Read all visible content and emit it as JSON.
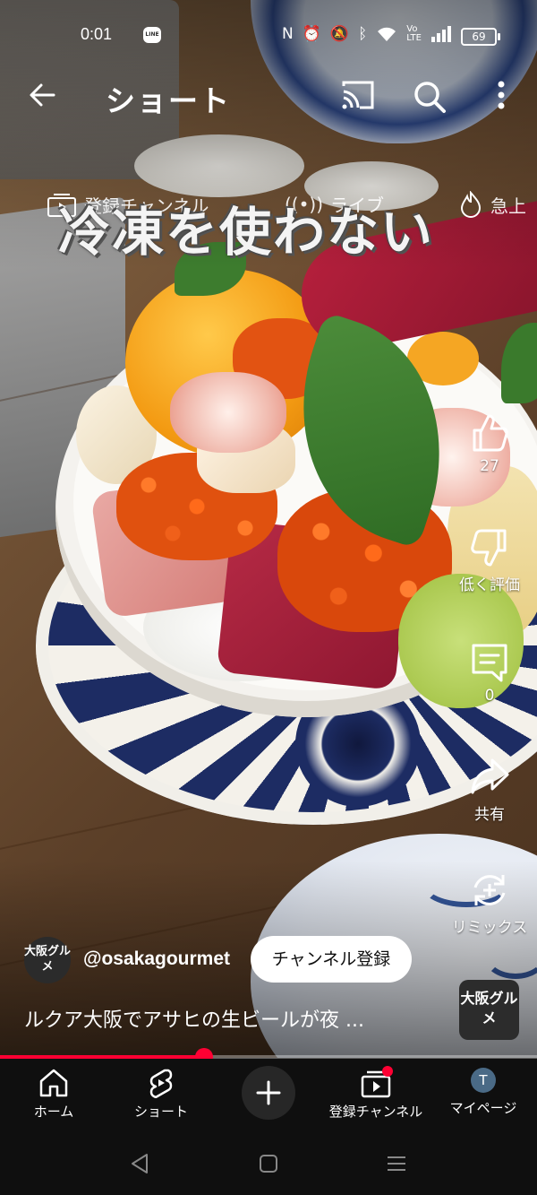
{
  "status_bar": {
    "time": "0:01",
    "line_icon_text": "LINE",
    "battery": "69",
    "icons": [
      "nfc-icon",
      "alarm-icon",
      "mute-icon",
      "bluetooth-icon",
      "wifi-icon",
      "volte-icon",
      "signal-icon"
    ]
  },
  "header": {
    "title": "ショート"
  },
  "subtabs": {
    "subscriptions": "登録チャンネル",
    "live": "ライブ",
    "trending": "急上"
  },
  "video": {
    "caption": "冷凍を使わない",
    "channel_avatar_text": "大阪グルメ",
    "handle": "@osakagourmet",
    "subscribe_label": "チャンネル登録",
    "description": "ルクア大阪でアサヒの生ビールが夜 ...",
    "sound_badge_text": "大阪グルメ",
    "progress": 0.38
  },
  "actions": {
    "like_count": "27",
    "dislike_label": "低く評価",
    "comment_count": "0",
    "share_label": "共有",
    "remix_label": "リミックス"
  },
  "bottom_nav": {
    "home": "ホーム",
    "shorts": "ショート",
    "subscriptions": "登録チャンネル",
    "mypage": "マイページ",
    "avatar_letter": "T"
  },
  "colors": {
    "accent": "#ff0033",
    "background": "#0f0f0f"
  }
}
